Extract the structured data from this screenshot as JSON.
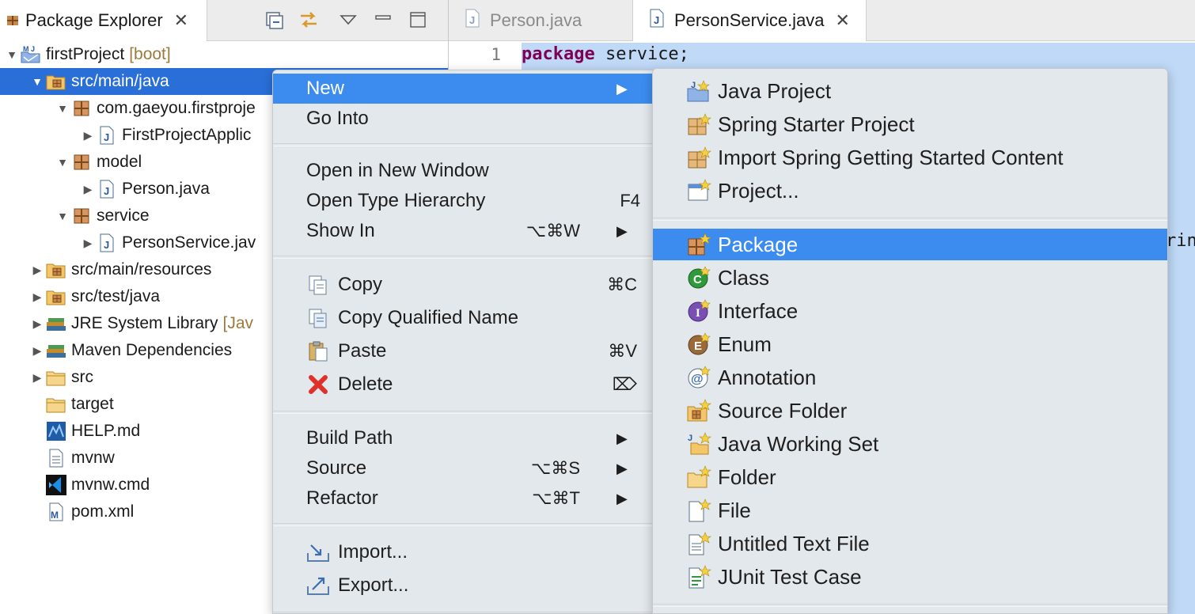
{
  "package_explorer": {
    "tab_title": "Package Explorer",
    "toolbar": [
      "collapse-all-icon",
      "link-with-editor-icon",
      "view-menu-icon",
      "minimize-icon",
      "maximize-icon"
    ],
    "tree": [
      {
        "label": "firstProject",
        "decoration": "[boot]",
        "icon": "spring-project-icon",
        "twisty": "expanded",
        "depth": 0
      },
      {
        "label": "src/main/java",
        "icon": "source-folder-icon",
        "twisty": "expanded",
        "depth": 1,
        "selected": true
      },
      {
        "label": "com.gaeyou.firstproje",
        "icon": "package-icon",
        "twisty": "expanded",
        "depth": 2
      },
      {
        "label": "FirstProjectApplic",
        "icon": "java-file-icon",
        "twisty": "collapsed",
        "depth": 3
      },
      {
        "label": "model",
        "icon": "package-icon",
        "twisty": "expanded",
        "depth": 2
      },
      {
        "label": "Person.java",
        "icon": "java-file-icon",
        "twisty": "collapsed",
        "depth": 3
      },
      {
        "label": "service",
        "icon": "package-icon",
        "twisty": "expanded",
        "depth": 2
      },
      {
        "label": "PersonService.jav",
        "icon": "java-file-icon",
        "twisty": "collapsed",
        "depth": 3
      },
      {
        "label": "src/main/resources",
        "icon": "source-folder-icon",
        "twisty": "collapsed",
        "depth": 1
      },
      {
        "label": "src/test/java",
        "icon": "source-folder-icon",
        "twisty": "collapsed",
        "depth": 1
      },
      {
        "label": "JRE System Library",
        "decoration": "[Jav",
        "icon": "library-icon",
        "twisty": "collapsed",
        "depth": 1
      },
      {
        "label": "Maven Dependencies",
        "icon": "library-icon",
        "twisty": "collapsed",
        "depth": 1
      },
      {
        "label": "src",
        "icon": "folder-icon",
        "twisty": "collapsed",
        "depth": 1
      },
      {
        "label": "target",
        "icon": "folder-icon",
        "twisty": "none",
        "depth": 1
      },
      {
        "label": "HELP.md",
        "icon": "markdown-file-icon",
        "twisty": "none",
        "depth": 1
      },
      {
        "label": "mvnw",
        "icon": "text-file-icon",
        "twisty": "none",
        "depth": 1
      },
      {
        "label": "mvnw.cmd",
        "icon": "vscode-file-icon",
        "twisty": "none",
        "depth": 1
      },
      {
        "label": "pom.xml",
        "icon": "maven-pom-icon",
        "twisty": "none",
        "depth": 1
      }
    ]
  },
  "editor": {
    "tabs": [
      {
        "label": "Person.java",
        "active": false
      },
      {
        "label": "PersonService.java",
        "active": true
      }
    ],
    "line_number": "1",
    "keyword": "package",
    "code_rest": " service;",
    "peek_text": "rin"
  },
  "context_menu": {
    "items": [
      {
        "type": "item",
        "label": "New",
        "arrow": true,
        "highlighted": true
      },
      {
        "type": "item",
        "label": "Go Into"
      },
      {
        "type": "sep"
      },
      {
        "type": "item",
        "label": "Open in New Window"
      },
      {
        "type": "item",
        "label": "Open Type Hierarchy",
        "shortcut": "F4"
      },
      {
        "type": "item",
        "label": "Show In",
        "shortcut": "⌥⌘W",
        "arrow": true
      },
      {
        "type": "sep"
      },
      {
        "type": "item",
        "label": "Copy",
        "icon": "copy-icon",
        "shortcut": "⌘C"
      },
      {
        "type": "item",
        "label": "Copy Qualified Name",
        "icon": "copy-qualified-name-icon"
      },
      {
        "type": "item",
        "label": "Paste",
        "icon": "paste-icon",
        "shortcut": "⌘V"
      },
      {
        "type": "item",
        "label": "Delete",
        "icon": "delete-icon",
        "shortcut": "⌦"
      },
      {
        "type": "sep"
      },
      {
        "type": "item",
        "label": "Build Path",
        "arrow": true
      },
      {
        "type": "item",
        "label": "Source",
        "shortcut": "⌥⌘S",
        "arrow": true
      },
      {
        "type": "item",
        "label": "Refactor",
        "shortcut": "⌥⌘T",
        "arrow": true
      },
      {
        "type": "sep"
      },
      {
        "type": "item",
        "label": "Import...",
        "icon": "import-icon"
      },
      {
        "type": "item",
        "label": "Export...",
        "icon": "export-icon"
      },
      {
        "type": "sep"
      }
    ]
  },
  "new_submenu": {
    "items": [
      {
        "type": "item",
        "label": "Java Project",
        "icon": "java-project-icon"
      },
      {
        "type": "item",
        "label": "Spring Starter Project",
        "icon": "spring-starter-icon"
      },
      {
        "type": "item",
        "label": "Import Spring Getting Started Content",
        "icon": "spring-import-icon"
      },
      {
        "type": "item",
        "label": "Project...",
        "icon": "project-icon"
      },
      {
        "type": "sep"
      },
      {
        "type": "item",
        "label": "Package",
        "icon": "new-package-icon",
        "highlighted": true
      },
      {
        "type": "item",
        "label": "Class",
        "icon": "class-icon"
      },
      {
        "type": "item",
        "label": "Interface",
        "icon": "interface-icon"
      },
      {
        "type": "item",
        "label": "Enum",
        "icon": "enum-icon"
      },
      {
        "type": "item",
        "label": "Annotation",
        "icon": "annotation-icon"
      },
      {
        "type": "item",
        "label": "Source Folder",
        "icon": "source-folder-new-icon"
      },
      {
        "type": "item",
        "label": "Java Working Set",
        "icon": "working-set-icon"
      },
      {
        "type": "item",
        "label": "Folder",
        "icon": "new-folder-icon"
      },
      {
        "type": "item",
        "label": "File",
        "icon": "new-file-icon"
      },
      {
        "type": "item",
        "label": "Untitled Text File",
        "icon": "untitled-text-file-icon"
      },
      {
        "type": "item",
        "label": "JUnit Test Case",
        "icon": "junit-icon"
      },
      {
        "type": "sep"
      }
    ]
  },
  "colors": {
    "selection": "#2a6fd8",
    "menu_highlight": "#3c8cf0",
    "menu_bg": "#e3e8ed",
    "editor_selection": "#bfd9f7",
    "keyword": "#7f0055",
    "decoration": "#9a7b3c"
  }
}
